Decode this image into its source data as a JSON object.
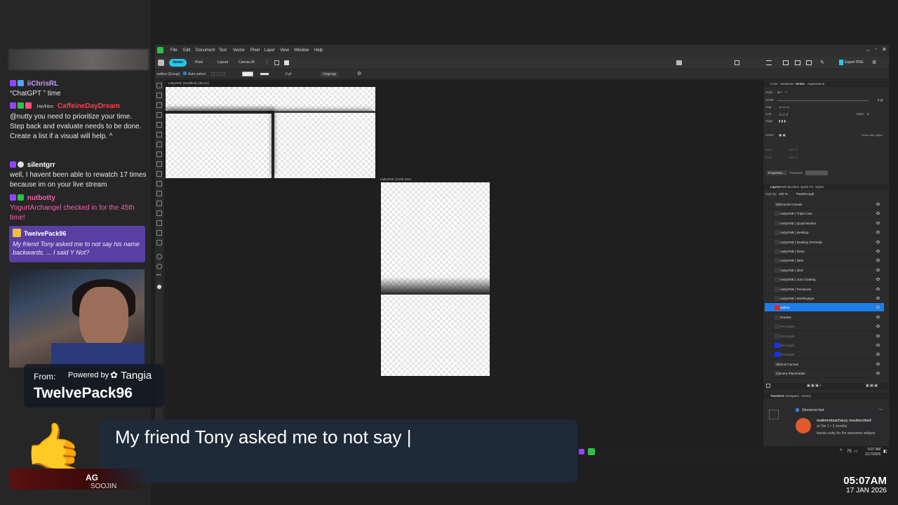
{
  "chat": {
    "messages": [
      {
        "user": "iiChrisRL",
        "color": "#c39cff",
        "text": "“ChatGPT ” time",
        "pronoun": ""
      },
      {
        "user": "CaffeineDayDream",
        "color": "#ff3b4c",
        "pronoun": "He/Him",
        "text": "@nutty you need to prioritize your time. Step back and evaluate    needs to be done. Create a list if a visual will help. ^"
      },
      {
        "user": "silentgrr",
        "color": "#ffffff",
        "pronoun": "",
        "text": "well, I havent been able to rewatch 17 times because im on your live stream"
      },
      {
        "user": "nutbotty",
        "color": "#ff5ca8",
        "pronoun": "",
        "text": "YogurtArchangel checked in for the 45th time!"
      }
    ],
    "redeem": {
      "user": "TwelvePack96",
      "text": "My friend Tony asked me to not say his name backwards. ... I said Y Not?"
    }
  },
  "app": {
    "menu": [
      "File",
      "Edit",
      "Document",
      "Text",
      "Vector",
      "Pixel",
      "Layer",
      "View",
      "Window",
      "Help"
    ],
    "personas": [
      "Vector",
      "Pixel",
      "Layout",
      "Canvas AI"
    ],
    "export_label": "Export PNG",
    "context": {
      "selection": "outline (Group)",
      "autoselect": "Auto-select",
      "stroke_width": "0 pt",
      "ungroup": "Ungroup"
    },
    "doc_tab": "nuttyONE (Modified) (35.1%)",
    "artboard_label": "nuttyONE | Desk Cam",
    "panel_tabs_top": [
      "Color",
      "Swatches",
      "Stroke",
      "Appearance"
    ],
    "stroke": {
      "style_label": "Style:",
      "width_label": "Width:",
      "width_value": "0 pt",
      "cap_label": "Cap:",
      "join_label": "Join:",
      "mitre_label": "Mitre:",
      "mitre_value": "2",
      "align_label": "Align:",
      "order_label": "Order:",
      "scale_label": "Scale with object",
      "start_label": "Start:",
      "end_label": "End:",
      "pct1": "100 %",
      "pct2": "100 %",
      "properties_label": "Properties...",
      "pressure_label": "Pressure"
    },
    "panel_tabs_layers": [
      "Layers",
      "Path Brushes",
      "Quick FX",
      "Styles"
    ],
    "opacity_label": "Opacity:",
    "opacity_value": "100 %",
    "blend_mode": "Passthrough",
    "layers": [
      {
        "name": "Horizontal Canvas",
        "state": "top"
      },
      {
        "name": "nuttyONE | Triple Cam",
        "state": "normal"
      },
      {
        "name": "nuttyONE | Quad Monitor",
        "state": "normal"
      },
      {
        "name": "nuttyONE | Desktop",
        "state": "normal"
      },
      {
        "name": "nuttyONE | Desktop (Portrait)",
        "state": "normal"
      },
      {
        "name": "nuttyONE | Retro",
        "state": "normal"
      },
      {
        "name": "nuttyONE | NDS",
        "state": "normal"
      },
      {
        "name": "nuttyONE | 3DS",
        "state": "normal"
      },
      {
        "name": "nuttyONE | Just Chatting",
        "state": "normal"
      },
      {
        "name": "nuttyONE | Pentacam",
        "state": "normal"
      },
      {
        "name": "nuttyONE | Monkeytype",
        "state": "normal"
      },
      {
        "name": "outline",
        "state": "selected"
      },
      {
        "name": "shadow",
        "state": "normal"
      },
      {
        "name": "Rectangle",
        "state": "dim"
      },
      {
        "name": "Rectangle",
        "state": "dim"
      },
      {
        "name": "Rectangle",
        "state": "dim"
      },
      {
        "name": "Rectangle",
        "state": "dim"
      },
      {
        "name": "Vertical Canvas",
        "state": "top"
      },
      {
        "name": "Camera Placeholder",
        "state": "top"
      }
    ],
    "bottom_tabs": [
      "Transform",
      "Navigator",
      "History"
    ]
  },
  "taskbar": {
    "tray_num": "75",
    "time": "5:07 AM",
    "date": "1/17/2026"
  },
  "toast": {
    "app": "Streamer.bot",
    "title": "realimnotzacharyy resubscribed",
    "line2": "at Tier 1 • 2 months",
    "line3": "thanks nutty for the awesome widgets"
  },
  "tts": {
    "from_label": "From:",
    "powered_label": "Powered by",
    "brand": "Tangia",
    "sender": "TwelvePack96",
    "subtitle": "My friend Tony asked me to not say |"
  },
  "artist": {
    "line1": "AG",
    "line2": "SOOJIN"
  },
  "clock": {
    "time": "05:07AM",
    "date": "17 JAN 2026"
  },
  "colors": {
    "accent_blue": "#1e7ee8",
    "persona_cyan": "#27c7e6",
    "redeem_purple": "#5a3fa3",
    "twitch_purple": "#9146ff"
  }
}
